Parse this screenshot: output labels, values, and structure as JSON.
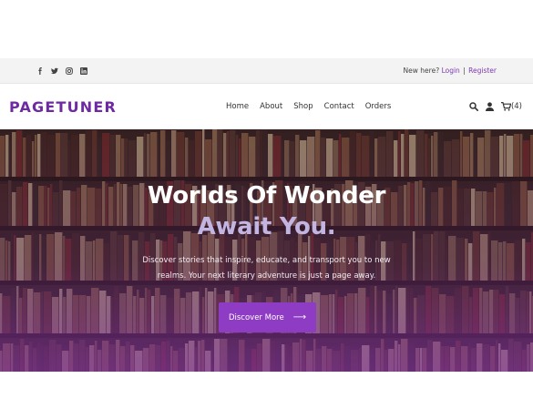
{
  "topbar": {
    "socials": [
      "facebook-icon",
      "twitter-icon",
      "instagram-icon",
      "linkedin-icon"
    ],
    "new_here": "New here?",
    "login": "Login",
    "separator": "|",
    "register": "Register"
  },
  "header": {
    "logo": "PAGETUNER",
    "nav": [
      "Home",
      "About",
      "Shop",
      "Contact",
      "Orders"
    ],
    "cart_count": "(4)"
  },
  "hero": {
    "title_line1": "Worlds Of Wonder",
    "title_line2": "Await You.",
    "description": "Discover stories that inspire, educate, and transport you to new realms. Your next literary adventure is just a page away.",
    "cta_label": "Discover More",
    "cta_arrow": "⟶"
  },
  "colors": {
    "brand": "#6e2aa3",
    "accent": "#8e3cc4",
    "link": "#7c3aad",
    "subtitle": "#c3b5e2"
  }
}
